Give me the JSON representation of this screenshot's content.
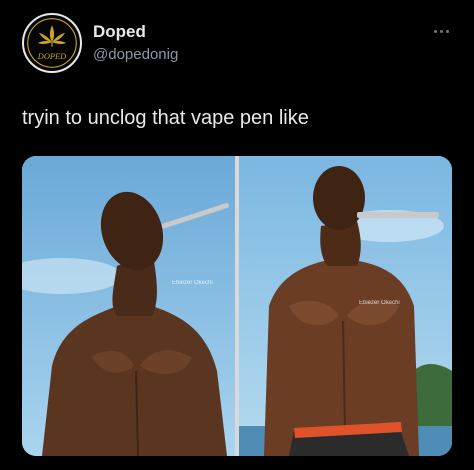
{
  "account": {
    "display_name": "Doped",
    "handle": "@dopedonig",
    "avatar_logo_text": "DOPED"
  },
  "tweet": {
    "text": "tryin to unclog that vape pen like"
  },
  "media": {
    "left_watermark": "Ebiezer Okechi",
    "right_watermark": "Ebiezer Okechi"
  },
  "colors": {
    "background": "#000000",
    "text": "#e7e9ea",
    "secondary_text": "#8b98a5",
    "logo_gold": "#c9a227"
  }
}
